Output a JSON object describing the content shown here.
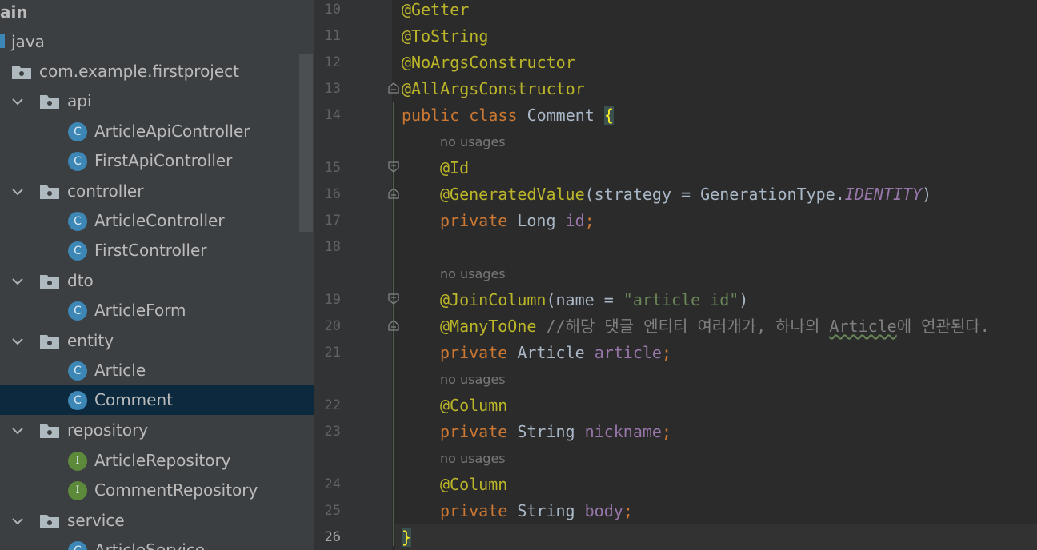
{
  "project_tree": [
    {
      "label": "ain",
      "kind": "module"
    },
    {
      "label": "java",
      "kind": "source-root"
    },
    {
      "label": "com.example.firstproject",
      "kind": "package"
    },
    {
      "label": "api",
      "kind": "package"
    },
    {
      "label": "ArticleApiController",
      "kind": "class"
    },
    {
      "label": "FirstApiController",
      "kind": "class"
    },
    {
      "label": "controller",
      "kind": "package"
    },
    {
      "label": "ArticleController",
      "kind": "class"
    },
    {
      "label": "FirstController",
      "kind": "class"
    },
    {
      "label": "dto",
      "kind": "package"
    },
    {
      "label": "ArticleForm",
      "kind": "class"
    },
    {
      "label": "entity",
      "kind": "package"
    },
    {
      "label": "Article",
      "kind": "class"
    },
    {
      "label": "Comment",
      "kind": "class",
      "selected": true
    },
    {
      "label": "repository",
      "kind": "package"
    },
    {
      "label": "ArticleRepository",
      "kind": "interface"
    },
    {
      "label": "CommentRepository",
      "kind": "interface"
    },
    {
      "label": "service",
      "kind": "package"
    },
    {
      "label": "ArticleService",
      "kind": "class"
    }
  ],
  "icons": {
    "class_letter": "C",
    "interface_letter": "I"
  },
  "editor": {
    "line_numbers": [
      "10",
      "11",
      "12",
      "13",
      "14",
      "15",
      "16",
      "17",
      "18",
      "19",
      "20",
      "21",
      "22",
      "23",
      "24",
      "25",
      "26"
    ],
    "current_line": "26",
    "inlay_hint": "no usages",
    "code": {
      "l10": {
        "ann": "@Getter"
      },
      "l11": {
        "ann": "@ToString"
      },
      "l12": {
        "ann": "@NoArgsConstructor"
      },
      "l13": {
        "ann": "@AllArgsConstructor"
      },
      "l14": {
        "kw1": "public",
        "kw2": "class",
        "name": "Comment",
        "brace": "{"
      },
      "l15": {
        "ann": "@Id"
      },
      "l16": {
        "ann": "@GeneratedValue",
        "open": "(",
        "param": "strategy = GenerationType.",
        "const": "IDENTITY",
        "close": ")"
      },
      "l17": {
        "kw": "private",
        "type": "Long",
        "field": "id",
        "semi": ";"
      },
      "l19": {
        "ann": "@JoinColumn",
        "open": "(",
        "param": "name = ",
        "str": "\"article_id\"",
        "close": ")"
      },
      "l20": {
        "ann": "@ManyToOne",
        "cmt1": "//해당 댓글 엔티티 여러개가, 하나의 ",
        "cmt_word": "Article",
        "cmt2": "에 연관된다."
      },
      "l21": {
        "kw": "private",
        "type": "Article",
        "field": "article",
        "semi": ";"
      },
      "l22": {
        "ann": "@Column"
      },
      "l23": {
        "kw": "private",
        "type": "String",
        "field": "nickname",
        "semi": ";"
      },
      "l24": {
        "ann": "@Column"
      },
      "l25": {
        "kw": "private",
        "type": "String",
        "field": "body",
        "semi": ";"
      },
      "l26": {
        "brace": "}"
      }
    }
  },
  "colors": {
    "annotation": "#bbb529",
    "keyword": "#cc7832",
    "field": "#9876aa",
    "string": "#6a8759",
    "comment": "#808080",
    "selection": "#0d293e"
  }
}
